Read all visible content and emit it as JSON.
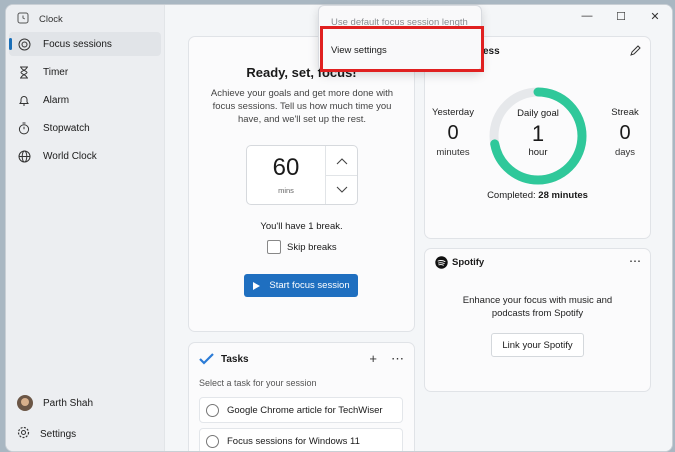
{
  "app": {
    "title": "Clock"
  },
  "nav": [
    {
      "label": "Focus sessions",
      "icon": "focus-icon",
      "active": true
    },
    {
      "label": "Timer",
      "icon": "hourglass-icon"
    },
    {
      "label": "Alarm",
      "icon": "bell-icon"
    },
    {
      "label": "Stopwatch",
      "icon": "stopwatch-icon"
    },
    {
      "label": "World Clock",
      "icon": "globe-icon"
    }
  ],
  "user": {
    "name": "Parth Shah"
  },
  "settings": {
    "label": "Settings"
  },
  "window_controls": {
    "minimize": "—",
    "maximize": "☐",
    "close": "✕"
  },
  "focus": {
    "title": "Ready, set, focus!",
    "description": "Achieve your goals and get more done with focus sessions. Tell us how much time you have, and we'll set up the rest.",
    "minutes": "60",
    "unit": "mins",
    "breaks_text": "You'll have 1 break.",
    "skip_label": "Skip breaks",
    "start_label": "Start focus session"
  },
  "tasks": {
    "title": "Tasks",
    "subtitle": "Select a task for your session",
    "items": [
      "Google Chrome article for TechWiser",
      "Focus sessions for Windows 11"
    ]
  },
  "progress": {
    "title_fragment": "ess",
    "yesterday": {
      "label": "Yesterday",
      "value": "0",
      "unit": "minutes"
    },
    "goal": {
      "label": "Daily goal",
      "value": "1",
      "unit": "hour",
      "fraction": 0.72
    },
    "streak": {
      "label": "Streak",
      "value": "0",
      "unit": "days"
    },
    "completed_label": "Completed:",
    "completed_value": "28 minutes",
    "ring_color": "#2fc89a"
  },
  "spotify": {
    "brand": "Spotify",
    "description": "Enhance your focus with music and podcasts from Spotify",
    "link_label": "Link your Spotify"
  },
  "menu": {
    "items": [
      {
        "label": "Use default focus session length",
        "disabled": true
      },
      {
        "label": "View settings",
        "disabled": false
      }
    ]
  },
  "colors": {
    "accent": "#1f6fc0",
    "highlight": "#e02020"
  }
}
